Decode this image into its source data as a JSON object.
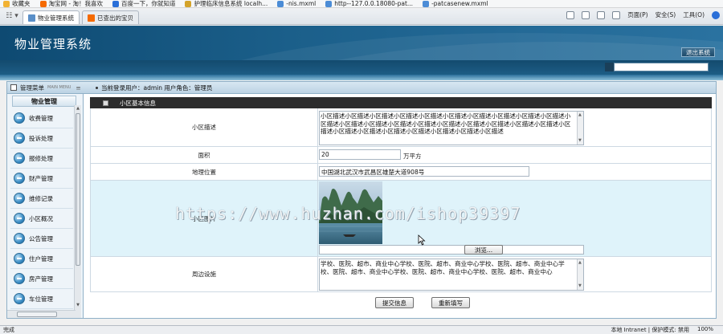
{
  "browser": {
    "favorites_bar": [
      {
        "label": "收藏夹",
        "color": "#f2b233"
      },
      {
        "label": "淘宝网 - 淘！我喜欢",
        "color": "#f56a00"
      },
      {
        "label": "百度一下，你就知道",
        "color": "#2a6fd8"
      },
      {
        "label": "护理临床信息系统 localh...",
        "color": "#d4a32a"
      },
      {
        "label": "-nis.mxml",
        "color": "#4c8cd6"
      },
      {
        "label": "http--127.0.0.18080-pat...",
        "color": "#4c8cd6"
      },
      {
        "label": "-patcasenew.mxml",
        "color": "#4c8cd6"
      }
    ],
    "tabs": [
      {
        "label": "物业管理系统",
        "active": true,
        "color": "#5a8fc8"
      },
      {
        "label": "已查出的宝贝",
        "active": false,
        "color": "#f56a00"
      }
    ],
    "commands": [
      "页面(P)",
      "安全(S)",
      "工具(O)"
    ],
    "status": {
      "left": "完成",
      "zone": "本地 Intranet | 保护模式: 禁用",
      "zoom": "100%"
    }
  },
  "app": {
    "title": "物业管理系统",
    "logout_label": "退出系统",
    "menu_label": "管理菜单",
    "menu_sub": "MAIN MENU",
    "current_user": "当前登录用户：admin  用户角色：管理员",
    "sidebar_title": "物业管理",
    "sidebar_items": [
      "收费管理",
      "投诉处理",
      "报修处理",
      "财产管理",
      "维修记录",
      "小区概况",
      "公告管理",
      "住户管理",
      "房产管理",
      "车位管理"
    ]
  },
  "form": {
    "section_title": "小区基本信息",
    "fields": {
      "description_label": "小区描述",
      "description_value": "小区描述小区描述小区描述小区描述小区描述小区描述小区描述小区描述小区描述小区描述小区描述小区描述小区描述小区描述小区描述小区描述小区描述小区描述小区描述小区描述小区描述小区描述小区描述小区描述小区描述小区描述小区描述小区描述",
      "area_label": "面积",
      "area_value": "20",
      "area_unit": "万平方",
      "location_label": "地理位置",
      "location_value": "中国湖北武汉市武昌区雄楚大道908号",
      "image_label": "小区图片",
      "browse_label": "浏览...",
      "facilities_label": "周边设施",
      "facilities_value": "学校、医院、超市、商业中心学校、医院、超市、商业中心学校、医院、超市、商业中心学校、医院、超市、商业中心学校、医院、超市、商业中心学校、医院、超市、商业中心"
    },
    "submit_label": "提交信息",
    "reset_label": "重新填写"
  },
  "watermark": "https://www.huzhan.com/ishop39397"
}
